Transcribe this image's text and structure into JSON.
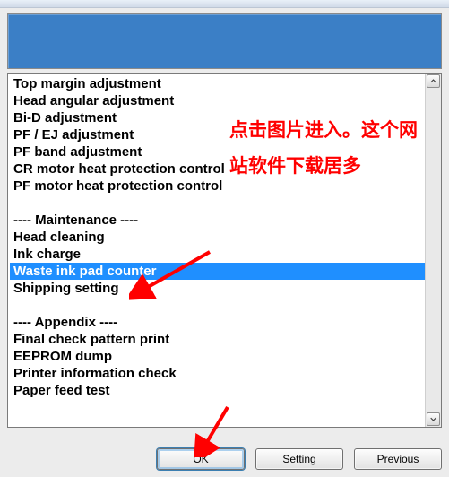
{
  "list": {
    "items": [
      "Top margin adjustment",
      "Head angular adjustment",
      "Bi-D adjustment",
      "PF / EJ adjustment",
      "PF band adjustment",
      "CR motor heat protection control",
      "PF motor heat protection control",
      "",
      "---- Maintenance ----",
      "Head cleaning",
      "Ink charge",
      "Waste ink pad counter",
      "Shipping setting",
      "",
      "---- Appendix ----",
      "Final check pattern print",
      "EEPROM dump",
      "Printer information check",
      "Paper feed test"
    ],
    "selected_index": 11
  },
  "buttons": {
    "ok": "OK",
    "setting": "Setting",
    "previous": "Previous"
  },
  "overlay": {
    "line1": "点击图片进入。这个网",
    "line2": "站软件下载居多"
  },
  "colors": {
    "selection": "#1f8fff",
    "overlay_red": "#ff0000",
    "header_blue": "#3b7fc6"
  }
}
